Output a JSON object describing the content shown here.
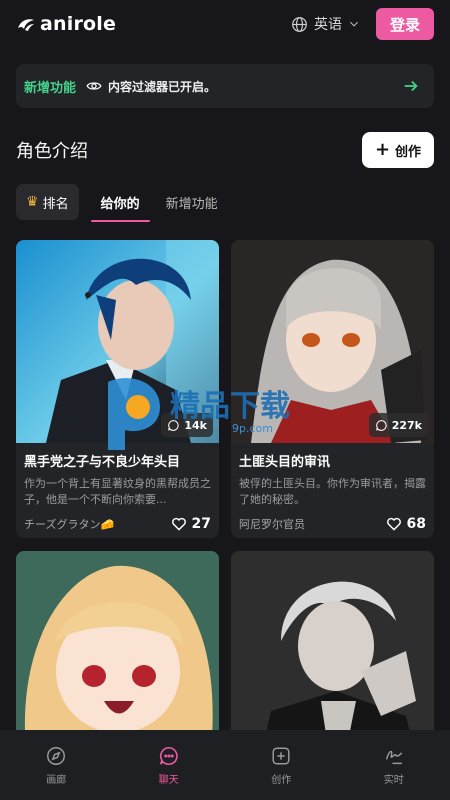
{
  "brand": {
    "name": "anirole"
  },
  "header": {
    "language": "英语",
    "login": "登录"
  },
  "notice": {
    "tag": "新增功能",
    "message": "内容过滤器已开启。"
  },
  "section": {
    "title": "角色介绍",
    "create": "创作"
  },
  "tabs": [
    {
      "label": "排名"
    },
    {
      "label": "给你的",
      "active": true
    },
    {
      "label": "新增功能"
    }
  ],
  "cards": [
    {
      "count": "14k",
      "title": "黑手党之子与不良少年头目",
      "desc": "作为一个背上有显著纹身的黑帮成员之子，他是一个不断向你索要...",
      "author": "チーズグラタン🧀",
      "likes": "27"
    },
    {
      "count": "227k",
      "title": "土匪头目的审讯",
      "desc": "被俘的土匪头目。你作为审讯者，揭露了她的秘密。",
      "author": "阿尼罗尔官员",
      "likes": "68"
    },
    {},
    {}
  ],
  "watermark": {
    "text": "精品下载",
    "url": "9p.com"
  },
  "nav": [
    {
      "label": "画廊",
      "icon": "compass-icon"
    },
    {
      "label": "聊天",
      "icon": "chat-icon",
      "active": true
    },
    {
      "label": "创作",
      "icon": "plus-square-icon"
    },
    {
      "label": "实时",
      "icon": "scribble-icon"
    }
  ],
  "colors": {
    "accent": "#ee5aa1",
    "notice_tag": "#43d38a",
    "background": "#17171b",
    "card": "#232428"
  }
}
